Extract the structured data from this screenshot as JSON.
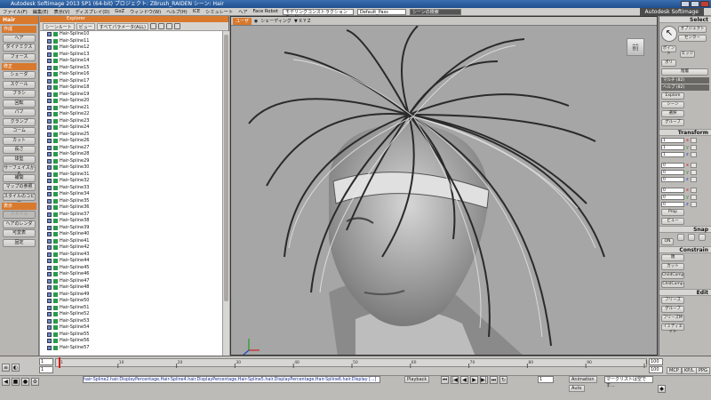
{
  "window": {
    "title": "Autodesk Softimage 2013 SP1 (64-bit)   プロジェクト: ZBrush_RAIDEN   シーン: Hair",
    "brand": "Autodesk Softimage"
  },
  "menu": [
    "ファイル(F)",
    "編集(E)",
    "表示(V)",
    "ディスプレイ(D)",
    "GoZ",
    "ウィンドウ(W)",
    "ヘルプ(H)",
    "ICE",
    "シミュレート",
    "ヘア",
    "Face Robot"
  ],
  "menu_fields": {
    "mode": "モデリングコンストラクションモード",
    "pass": "Default_Pass",
    "search": "シーンの検索"
  },
  "left_panel": {
    "header": "Hair",
    "create_label": "作成",
    "create_items": [
      "ヘア",
      "ダイナミクス",
      "フォース"
    ],
    "modify_label": "修正",
    "modify_items": [
      "シェーダ",
      "スケール",
      "ブラシ",
      "回転",
      "パフ",
      "クランプ",
      "コーム",
      "カット",
      "長さ",
      "球型",
      "サーフェイスから",
      "補間",
      "マップの参照",
      "スタイルのコピー"
    ],
    "display_label": "表示",
    "display_items": [
      "スタイル",
      "ヘアのレンダ",
      "可変表",
      "固定"
    ]
  },
  "explorer": {
    "title": "Explorer",
    "tool_scene": "シーンルート",
    "tool_view": "ビュー",
    "tool_params": "すべてパラメータ(ALL)",
    "items": [
      "Hair-Spline10",
      "Hair-Spline11",
      "Hair-Spline12",
      "Hair-Spline13",
      "Hair-Spline14",
      "Hair-Spline15",
      "Hair-Spline16",
      "Hair-Spline17",
      "Hair-Spline18",
      "Hair-Spline19",
      "Hair-Spline20",
      "Hair-Spline21",
      "Hair-Spline22",
      "Hair-Spline23",
      "Hair-Spline24",
      "Hair-Spline25",
      "Hair-Spline26",
      "Hair-Spline27",
      "Hair-Spline28",
      "Hair-Spline29",
      "Hair-Spline30",
      "Hair-Spline31",
      "Hair-Spline32",
      "Hair-Spline33",
      "Hair-Spline34",
      "Hair-Spline35",
      "Hair-Spline36",
      "Hair-Spline37",
      "Hair-Spline38",
      "Hair-Spline39",
      "Hair-Spline40",
      "Hair-Spline41",
      "Hair-Spline42",
      "Hair-Spline43",
      "Hair-Spline44",
      "Hair-Spline45",
      "Hair-Spline46",
      "Hair-Spline47",
      "Hair-Spline48",
      "Hair-Spline49",
      "Hair-Spline50",
      "Hair-Spline51",
      "Hair-Spline52",
      "Hair-Spline53",
      "Hair-Spline54",
      "Hair-Spline55",
      "Hair-Spline56",
      "Hair-Spline57"
    ]
  },
  "viewport": {
    "camera": "ユーザ",
    "display": "シェーディング",
    "view_cube_label": "前"
  },
  "right_panel": {
    "select_title": "Select",
    "select_btns": [
      "オブジェクト",
      "センター",
      "ポイント",
      "エッジ",
      "ポリ",
      "階層"
    ],
    "field1": "マルチ (82)",
    "field2": "ヘルプ (82)",
    "explore": "Explore",
    "scene": "シーン",
    "selection": "選択",
    "group": "グループ",
    "transform_title": "Transform",
    "xyz": [
      "x",
      "y",
      "z"
    ],
    "transform_values": [
      "1",
      "1",
      "1",
      "0",
      "0",
      "0",
      "0",
      "0",
      "0"
    ],
    "snap_title": "Snap",
    "snap_on": "ON",
    "constrain_title": "Constrain",
    "constrain_btns": [
      "親",
      "カット",
      "ChildComp",
      "ChldComp"
    ],
    "edit_title": "Edit",
    "edit_btns": [
      "フリーズ",
      "グループ",
      "フリーズM",
      "イミディエイト"
    ],
    "grid": "グリッド",
    "prop": "Prop",
    "view": "ビュー",
    "mcp": "MCP",
    "kp": "KP/L",
    "ppg": "PPG"
  },
  "timeline": {
    "start": "1",
    "end": "100",
    "end2": "100",
    "ticks": [
      "1",
      "10",
      "20",
      "30",
      "40",
      "50",
      "60",
      "70",
      "80",
      "90",
      "100"
    ]
  },
  "bottom": {
    "command": "hair-Spline2.hair.DisplayPercentage,Hair-Spline4.hair.DisplayPercentage,Hair-Spline5.hair.DisplayPercentage,Hair-Spline6.hair.Display [...]",
    "playback": "Playback",
    "animation": "Animation",
    "frame": "1",
    "auto": "Auto",
    "status": "マークリストは空です..."
  }
}
